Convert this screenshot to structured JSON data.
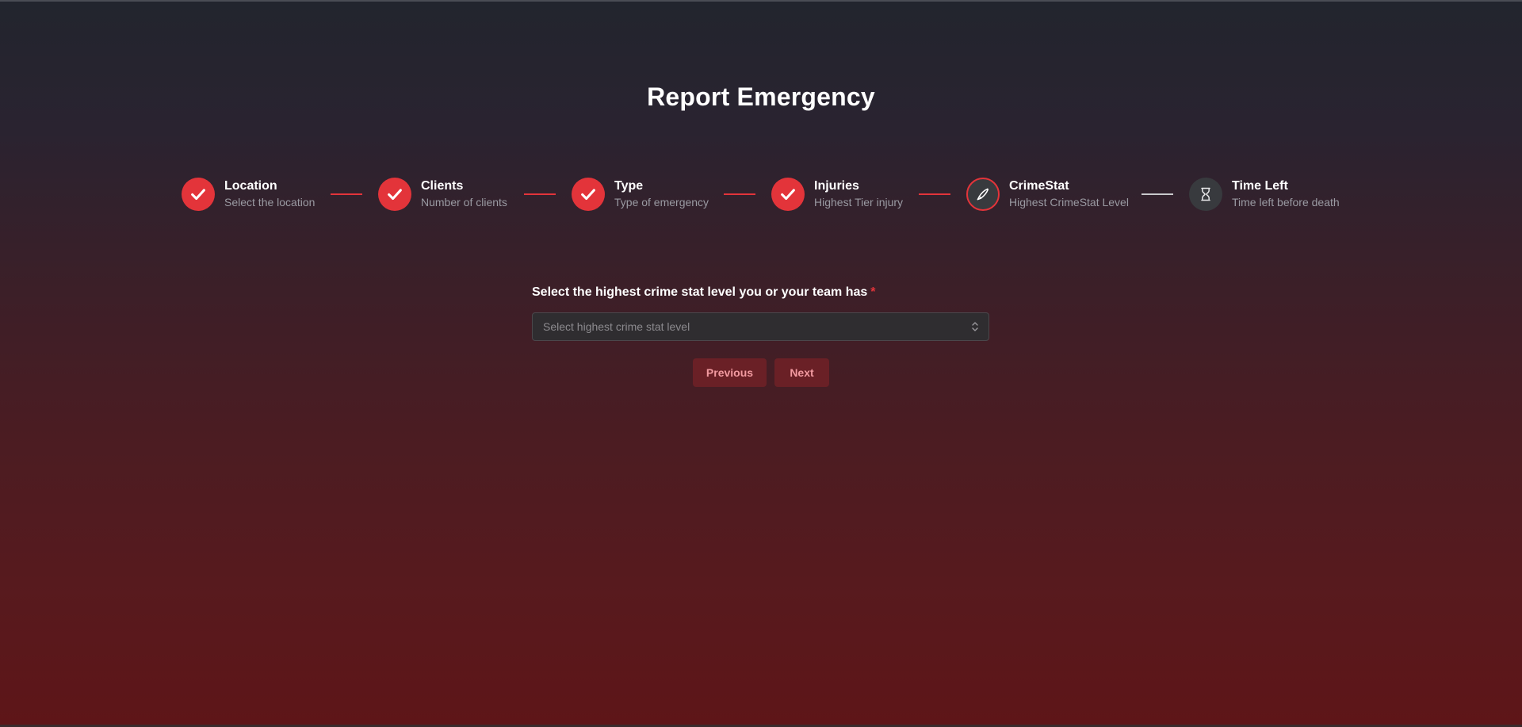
{
  "page": {
    "title": "Report Emergency"
  },
  "stepper": {
    "steps": [
      {
        "title": "Location",
        "description": "Select the location",
        "status": "done",
        "icon": "check-icon"
      },
      {
        "title": "Clients",
        "description": "Number of clients",
        "status": "done",
        "icon": "check-icon"
      },
      {
        "title": "Type",
        "description": "Type of emergency",
        "status": "done",
        "icon": "check-icon"
      },
      {
        "title": "Injuries",
        "description": "Highest Tier injury",
        "status": "done",
        "icon": "check-icon"
      },
      {
        "title": "CrimeStat",
        "description": "Highest CrimeStat Level",
        "status": "current",
        "icon": "knife-icon"
      },
      {
        "title": "Time Left",
        "description": "Time left before death",
        "status": "pending",
        "icon": "hourglass-icon"
      }
    ]
  },
  "form": {
    "label": "Select the highest crime stat level you or your team has",
    "required_mark": "*",
    "select_placeholder": "Select highest crime stat level"
  },
  "buttons": {
    "previous": "Previous",
    "next": "Next"
  },
  "colors": {
    "accent": "#e3343a",
    "button_bg": "#6a2026",
    "button_text": "#f29aa0"
  }
}
